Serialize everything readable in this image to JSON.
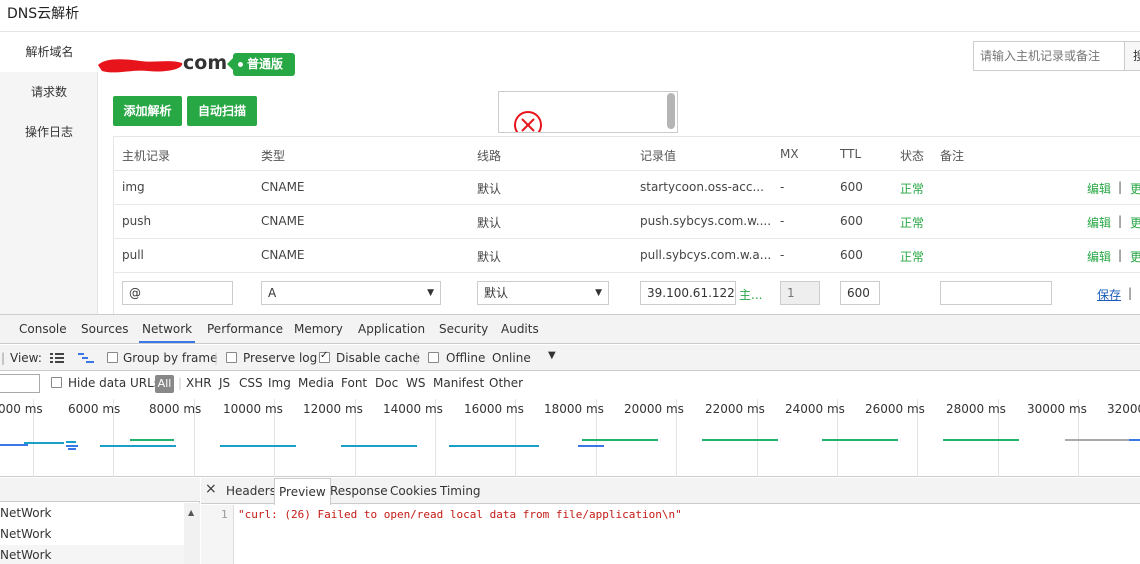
{
  "app": {
    "title": "DNS云解析",
    "sidebar": [
      "解析域名",
      "请求数",
      "操作日志"
    ],
    "domain_suffix": "com",
    "plan_badge": "普通版",
    "search_placeholder": "请输入主机记录或备注",
    "search_button": "搜",
    "add_button": "添加解析",
    "scan_button": "自动扫描",
    "columns": [
      "主机记录",
      "类型",
      "线路",
      "记录值",
      "MX",
      "TTL",
      "状态",
      "备注"
    ],
    "rows": [
      {
        "host": "img",
        "type": "CNAME",
        "line": "默认",
        "value": "startycoon.oss-acc...",
        "mx": "-",
        "ttl": "600",
        "status": "正常",
        "edit": "编辑",
        "more": "更"
      },
      {
        "host": "push",
        "type": "CNAME",
        "line": "默认",
        "value": "push.sybcys.com.w....",
        "mx": "-",
        "ttl": "600",
        "status": "正常",
        "edit": "编辑",
        "more": "更"
      },
      {
        "host": "pull",
        "type": "CNAME",
        "line": "默认",
        "value": "pull.sybcys.com.w.a...",
        "mx": "-",
        "ttl": "600",
        "status": "正常",
        "edit": "编辑",
        "more": "更"
      }
    ],
    "new_row": {
      "host": "@",
      "type": "A",
      "line": "默认",
      "value": "39.100.61.122",
      "value_hint": "主...",
      "mx": "1",
      "ttl": "600",
      "remark": "",
      "save": "保存",
      "sep": "|"
    }
  },
  "devtools": {
    "tabs": [
      "Console",
      "Sources",
      "Network",
      "Performance",
      "Memory",
      "Application",
      "Security",
      "Audits"
    ],
    "active_tab": "Network",
    "toolbar": {
      "view_label": "View:",
      "group_by_frame": "Group by frame",
      "preserve_log": "Preserve log",
      "disable_cache": "Disable cache",
      "offline": "Offline",
      "throttle": "Online"
    },
    "filters": {
      "hide_data_urls": "Hide data URLs",
      "types": [
        "All",
        "XHR",
        "JS",
        "CSS",
        "Img",
        "Media",
        "Font",
        "Doc",
        "WS",
        "Manifest",
        "Other"
      ]
    },
    "timeline_labels": [
      "000 ms",
      "6000 ms",
      "8000 ms",
      "10000 ms",
      "12000 ms",
      "14000 ms",
      "16000 ms",
      "18000 ms",
      "20000 ms",
      "22000 ms",
      "24000 ms",
      "26000 ms",
      "28000 ms",
      "30000 ms",
      "32000"
    ],
    "requests": [
      "NetWork",
      "NetWork",
      "NetWork"
    ],
    "detail_tabs": [
      "Headers",
      "Preview",
      "Response",
      "Cookies",
      "Timing"
    ],
    "active_detail_tab": "Preview",
    "preview_line_number": "1",
    "preview_text": "\"curl: (26) Failed to open/read local data from file/application\\n\"",
    "colors": {
      "accent_green": "#28a745",
      "devtools_blue": "#3b78e7",
      "error_red": "#c41a16"
    }
  }
}
